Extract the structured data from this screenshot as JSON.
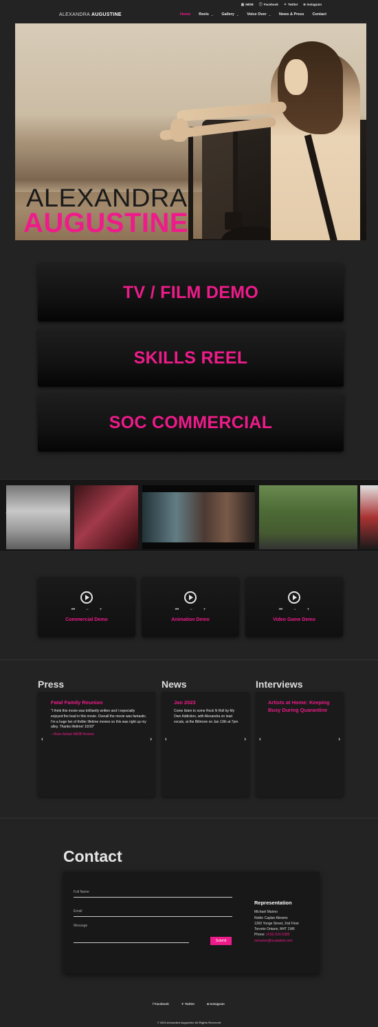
{
  "top_social": {
    "imdb": "IMDB",
    "facebook": "Facebook",
    "twitter": "Twitter",
    "instagram": "Instagram"
  },
  "brand": {
    "first": "ALEXANDRA",
    "last": "AUGUSTINE"
  },
  "nav": [
    {
      "label": "Home",
      "active": true
    },
    {
      "label": "Reels",
      "dropdown": true
    },
    {
      "label": "Gallery",
      "dropdown": true
    },
    {
      "label": "Voice Over",
      "dropdown": true
    },
    {
      "label": "News & Press"
    },
    {
      "label": "Contact"
    }
  ],
  "hero": {
    "line1": "ALEXANDRA",
    "line2": "AUGUSTINE"
  },
  "demos": [
    "TV / FILM DEMO",
    "SKILLS REEL",
    "SOC COMMERCIAL"
  ],
  "voice_cards": [
    {
      "label": "Commercial Demo"
    },
    {
      "label": "Animation Demo"
    },
    {
      "label": "Video Game Demo"
    }
  ],
  "player_controls": {
    "prev": "⏮",
    "minus": "−",
    "plus": "+"
  },
  "sections": {
    "press": "Press",
    "news": "News",
    "interviews": "Interviews"
  },
  "press": {
    "title": "Fatal Family Reunion",
    "quote": "\"I think this movie was brilliantly written and I especially enjoyed the lead in this movie. Overall the movie was fantastic. I'm a huge fan of thriller lifetime movies so this was right up my alley. Thanks lifetime! 10/10\"",
    "author": "– Brian Ashari IMDB Review"
  },
  "news": {
    "title": "Jan 2023",
    "body": "Come listen to some Rock N Roll by My Own Addiction, with Alexandra on lead vocals, at the Biltmore on Jan 13th at 7pm"
  },
  "interviews": {
    "title": "Artists at Home: Keeping Busy During Quarantine"
  },
  "arrows": {
    "left": "‹",
    "right": "›"
  },
  "contact": {
    "title": "Contact",
    "full_name": "Full Name",
    "email": "Email",
    "message": "Message",
    "submit": "Submit"
  },
  "representation": {
    "heading": "Representation",
    "name": "Michael Marino",
    "agency": "Noble Caplan Abrams",
    "address1": "1260 Yonge Street, 2nd Floor",
    "address2": "Toronto Ontario, M4T 1W6",
    "phone_label": "Phone:",
    "phone": "(416) 920-5385",
    "email": "mmarino@ncatalent.com"
  },
  "footer": {
    "facebook": "Facebook",
    "twitter": "Twitter",
    "instagram": "Instagram",
    "copyright": "© 2023 Alexandra Augustine All Rights Reserved"
  },
  "colors": {
    "accent": "#ee1b8a",
    "background": "#232323"
  }
}
